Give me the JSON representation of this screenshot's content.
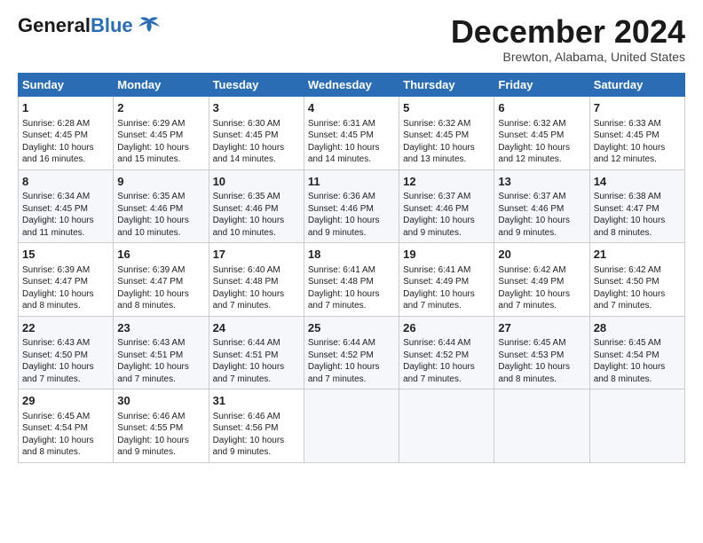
{
  "header": {
    "logo_general": "General",
    "logo_blue": "Blue",
    "month_title": "December 2024",
    "location": "Brewton, Alabama, United States"
  },
  "days_of_week": [
    "Sunday",
    "Monday",
    "Tuesday",
    "Wednesday",
    "Thursday",
    "Friday",
    "Saturday"
  ],
  "weeks": [
    [
      {
        "day": "1",
        "info": "Sunrise: 6:28 AM\nSunset: 4:45 PM\nDaylight: 10 hours\nand 16 minutes."
      },
      {
        "day": "2",
        "info": "Sunrise: 6:29 AM\nSunset: 4:45 PM\nDaylight: 10 hours\nand 15 minutes."
      },
      {
        "day": "3",
        "info": "Sunrise: 6:30 AM\nSunset: 4:45 PM\nDaylight: 10 hours\nand 14 minutes."
      },
      {
        "day": "4",
        "info": "Sunrise: 6:31 AM\nSunset: 4:45 PM\nDaylight: 10 hours\nand 14 minutes."
      },
      {
        "day": "5",
        "info": "Sunrise: 6:32 AM\nSunset: 4:45 PM\nDaylight: 10 hours\nand 13 minutes."
      },
      {
        "day": "6",
        "info": "Sunrise: 6:32 AM\nSunset: 4:45 PM\nDaylight: 10 hours\nand 12 minutes."
      },
      {
        "day": "7",
        "info": "Sunrise: 6:33 AM\nSunset: 4:45 PM\nDaylight: 10 hours\nand 12 minutes."
      }
    ],
    [
      {
        "day": "8",
        "info": "Sunrise: 6:34 AM\nSunset: 4:45 PM\nDaylight: 10 hours\nand 11 minutes."
      },
      {
        "day": "9",
        "info": "Sunrise: 6:35 AM\nSunset: 4:46 PM\nDaylight: 10 hours\nand 10 minutes."
      },
      {
        "day": "10",
        "info": "Sunrise: 6:35 AM\nSunset: 4:46 PM\nDaylight: 10 hours\nand 10 minutes."
      },
      {
        "day": "11",
        "info": "Sunrise: 6:36 AM\nSunset: 4:46 PM\nDaylight: 10 hours\nand 9 minutes."
      },
      {
        "day": "12",
        "info": "Sunrise: 6:37 AM\nSunset: 4:46 PM\nDaylight: 10 hours\nand 9 minutes."
      },
      {
        "day": "13",
        "info": "Sunrise: 6:37 AM\nSunset: 4:46 PM\nDaylight: 10 hours\nand 9 minutes."
      },
      {
        "day": "14",
        "info": "Sunrise: 6:38 AM\nSunset: 4:47 PM\nDaylight: 10 hours\nand 8 minutes."
      }
    ],
    [
      {
        "day": "15",
        "info": "Sunrise: 6:39 AM\nSunset: 4:47 PM\nDaylight: 10 hours\nand 8 minutes."
      },
      {
        "day": "16",
        "info": "Sunrise: 6:39 AM\nSunset: 4:47 PM\nDaylight: 10 hours\nand 8 minutes."
      },
      {
        "day": "17",
        "info": "Sunrise: 6:40 AM\nSunset: 4:48 PM\nDaylight: 10 hours\nand 7 minutes."
      },
      {
        "day": "18",
        "info": "Sunrise: 6:41 AM\nSunset: 4:48 PM\nDaylight: 10 hours\nand 7 minutes."
      },
      {
        "day": "19",
        "info": "Sunrise: 6:41 AM\nSunset: 4:49 PM\nDaylight: 10 hours\nand 7 minutes."
      },
      {
        "day": "20",
        "info": "Sunrise: 6:42 AM\nSunset: 4:49 PM\nDaylight: 10 hours\nand 7 minutes."
      },
      {
        "day": "21",
        "info": "Sunrise: 6:42 AM\nSunset: 4:50 PM\nDaylight: 10 hours\nand 7 minutes."
      }
    ],
    [
      {
        "day": "22",
        "info": "Sunrise: 6:43 AM\nSunset: 4:50 PM\nDaylight: 10 hours\nand 7 minutes."
      },
      {
        "day": "23",
        "info": "Sunrise: 6:43 AM\nSunset: 4:51 PM\nDaylight: 10 hours\nand 7 minutes."
      },
      {
        "day": "24",
        "info": "Sunrise: 6:44 AM\nSunset: 4:51 PM\nDaylight: 10 hours\nand 7 minutes."
      },
      {
        "day": "25",
        "info": "Sunrise: 6:44 AM\nSunset: 4:52 PM\nDaylight: 10 hours\nand 7 minutes."
      },
      {
        "day": "26",
        "info": "Sunrise: 6:44 AM\nSunset: 4:52 PM\nDaylight: 10 hours\nand 7 minutes."
      },
      {
        "day": "27",
        "info": "Sunrise: 6:45 AM\nSunset: 4:53 PM\nDaylight: 10 hours\nand 8 minutes."
      },
      {
        "day": "28",
        "info": "Sunrise: 6:45 AM\nSunset: 4:54 PM\nDaylight: 10 hours\nand 8 minutes."
      }
    ],
    [
      {
        "day": "29",
        "info": "Sunrise: 6:45 AM\nSunset: 4:54 PM\nDaylight: 10 hours\nand 8 minutes."
      },
      {
        "day": "30",
        "info": "Sunrise: 6:46 AM\nSunset: 4:55 PM\nDaylight: 10 hours\nand 9 minutes."
      },
      {
        "day": "31",
        "info": "Sunrise: 6:46 AM\nSunset: 4:56 PM\nDaylight: 10 hours\nand 9 minutes."
      },
      {
        "day": "",
        "info": ""
      },
      {
        "day": "",
        "info": ""
      },
      {
        "day": "",
        "info": ""
      },
      {
        "day": "",
        "info": ""
      }
    ]
  ]
}
